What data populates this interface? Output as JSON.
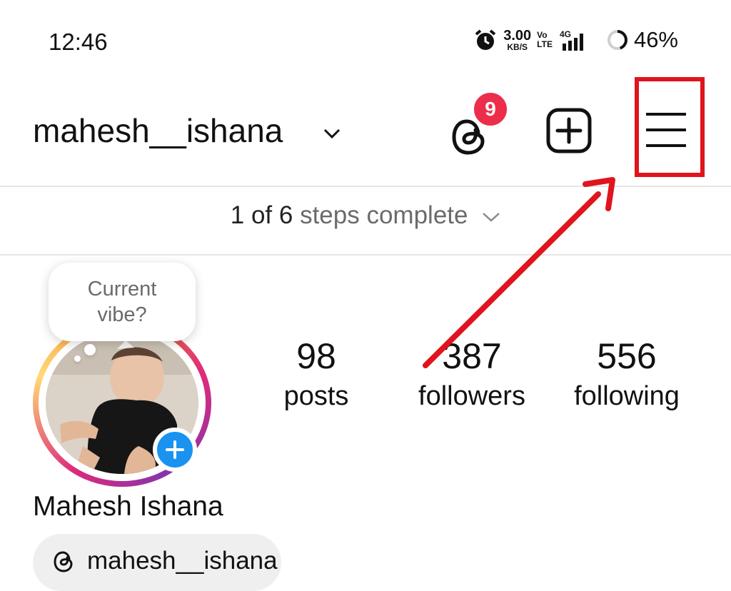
{
  "status_bar": {
    "time": "12:46",
    "net_speed_value": "3.00",
    "net_speed_unit": "KB/S",
    "volte_top": "Vo",
    "volte_bottom": "LTE",
    "network": "4G",
    "battery": "46%"
  },
  "header": {
    "username": "mahesh__ishana",
    "threads_badge": "9"
  },
  "steps": {
    "count": "1 of 6",
    "label": "steps complete"
  },
  "note": {
    "line1": "Current",
    "line2": "vibe?"
  },
  "stats": {
    "posts": {
      "value": "98",
      "label": "posts"
    },
    "followers": {
      "value": "387",
      "label": "followers"
    },
    "following": {
      "value": "556",
      "label": "following"
    }
  },
  "profile": {
    "full_name": "Mahesh Ishana",
    "threads_handle": "mahesh__ishana"
  },
  "colors": {
    "highlight": "#e0141c",
    "badge": "#ed2e4a",
    "add_story": "#1a93f0"
  }
}
